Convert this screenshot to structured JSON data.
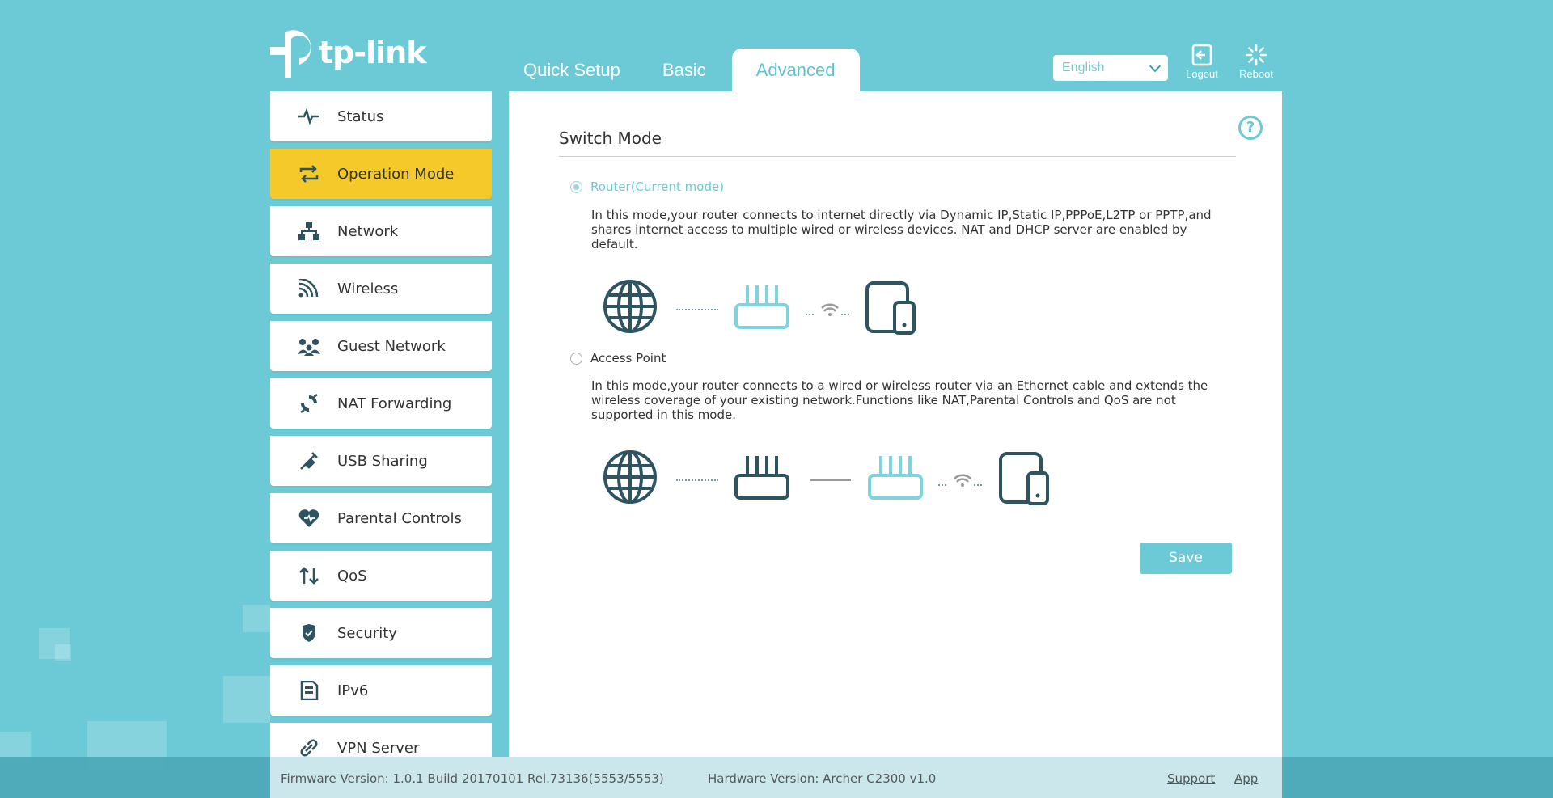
{
  "brand": {
    "logo_text": "tp-link"
  },
  "nav": {
    "tabs": [
      {
        "label": "Quick Setup",
        "active": false
      },
      {
        "label": "Basic",
        "active": false
      },
      {
        "label": "Advanced",
        "active": true
      }
    ]
  },
  "header": {
    "language": {
      "selected": "English"
    },
    "logout_label": "Logout",
    "reboot_label": "Reboot"
  },
  "sidebar": {
    "items": [
      {
        "label": "Status",
        "icon": "pulse-icon",
        "active": false
      },
      {
        "label": "Operation Mode",
        "icon": "switch-arrows-icon",
        "active": true
      },
      {
        "label": "Network",
        "icon": "network-tree-icon",
        "active": false
      },
      {
        "label": "Wireless",
        "icon": "wireless-signal-icon",
        "active": false
      },
      {
        "label": "Guest Network",
        "icon": "guests-icon",
        "active": false
      },
      {
        "label": "NAT Forwarding",
        "icon": "nat-cycle-icon",
        "active": false
      },
      {
        "label": "USB Sharing",
        "icon": "usb-icon",
        "active": false
      },
      {
        "label": "Parental Controls",
        "icon": "heart-icon",
        "active": false
      },
      {
        "label": "QoS",
        "icon": "qos-arrows-icon",
        "active": false
      },
      {
        "label": "Security",
        "icon": "shield-icon",
        "active": false
      },
      {
        "label": "IPv6",
        "icon": "ipv6-doc-icon",
        "active": false
      },
      {
        "label": "VPN Server",
        "icon": "link-icon",
        "active": false
      }
    ]
  },
  "main": {
    "section_title": "Switch Mode",
    "modes": [
      {
        "label": "Router(Current mode)",
        "selected": true,
        "description": "In this mode,your router connects to internet directly via Dynamic IP,Static IP,PPPoE,L2TP or PPTP,and shares internet access to multiple wired or wireless devices. NAT and DHCP server are enabled by default."
      },
      {
        "label": "Access Point",
        "selected": false,
        "description": "In this mode,your router connects to a wired or wireless router via an Ethernet cable and extends the wireless coverage of your existing network.Functions like NAT,Parental Controls and QoS are not supported in this mode."
      }
    ],
    "save_label": "Save"
  },
  "footer": {
    "firmware": "Firmware Version: 1.0.1 Build 20170101 Rel.73136(5553/5553)",
    "hardware": "Hardware Version: Archer C2300 v1.0",
    "support_label": "Support",
    "app_label": "App"
  },
  "colors": {
    "background": "#6ccad7",
    "active_menu": "#f5c92a",
    "accent": "#6ccad7",
    "icon_dark": "#2e5361"
  }
}
